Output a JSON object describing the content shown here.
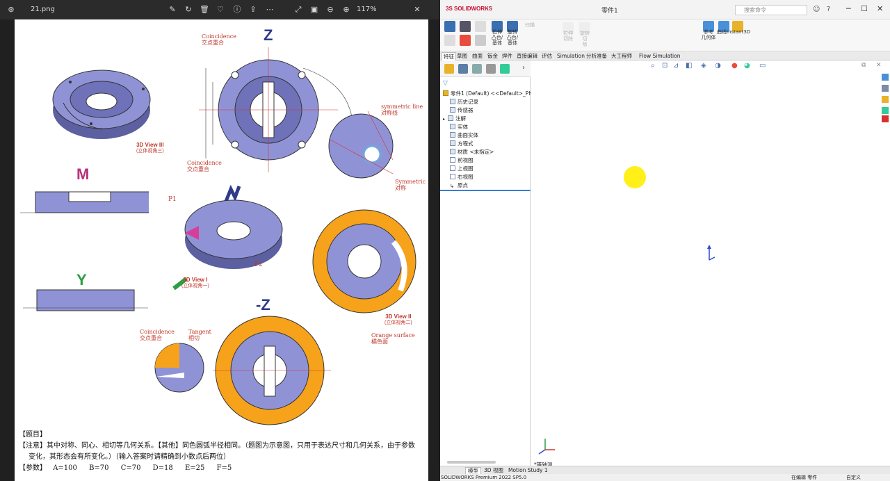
{
  "viewer": {
    "filename": "21.png",
    "zoom": "117%",
    "toolbar_icons": [
      "edit-icon",
      "rotate-icon",
      "delete-icon",
      "favorite-icon",
      "info-icon",
      "share-icon",
      "more-icon",
      "expand-icon",
      "crop-icon",
      "zoom-out-icon",
      "zoom-in-icon"
    ]
  },
  "drawing": {
    "views": {
      "z": "Z",
      "m": "M",
      "y": "Y",
      "neg_z": "-Z",
      "view3": {
        "title": "3D View III",
        "subtitle": "(立体视角三)"
      },
      "view1": {
        "title": "3D View I",
        "subtitle": "(立体视角一)"
      },
      "view2": {
        "title": "3D View II",
        "subtitle": "(立体视角二)"
      }
    },
    "labels": {
      "coincidence_top": "Coincidence",
      "coincidence_top_cn": "交点重合",
      "coincidence_mid": "Coincidence",
      "coincidence_mid_cn": "交点重合",
      "symmetric_line": "symmetric line",
      "symmetric_line_cn": "对称线",
      "symmetric": "Symmetric",
      "symmetric_cn": "对称",
      "p1": "P1",
      "p2": "P2",
      "coincidence_bottom": "Coincidence",
      "coincidence_bottom_cn": "交点重合",
      "tangent": "Tangent",
      "tangent_cn": "相切",
      "orange_surface": "Orange surface",
      "orange_surface_cn": "橘色面"
    },
    "notes": {
      "heading": "【题目】",
      "note_line1": "【注意】其中对称、同心、相切等几何关系。【其他】同色圆弧半径相同。（题图为示意图，只用于表达尺寸和几何关系，由于参数",
      "note_line2": "变化，其形态会有所变化。）（输入答案时请精确到小数点后两位）",
      "params_label": "【参数】",
      "params": [
        "A=100",
        "B=70",
        "C=70",
        "D=18",
        "E=25",
        "F=5"
      ]
    }
  },
  "solidworks": {
    "logo": "SOLIDWORKS",
    "document": "零件1",
    "search_placeholder": "搜索命令",
    "ribbon": {
      "extrude_boss": "拉伸\n凸台/\n基体",
      "revolve_boss": "旋转\n凸台/\n基体",
      "sweep": "扫描",
      "extrude_cut": "拉伸\n切除",
      "revolve_cut": "旋转\n切\n除",
      "ref_geometry": "参考\n几何体",
      "curves": "曲线",
      "instant3d": "Instant3D"
    },
    "tabs": [
      "特征",
      "草图",
      "曲面",
      "钣金",
      "焊件",
      "直接编辑",
      "评估",
      "Simulation",
      "分析准备",
      "大工程师",
      "Flow Simulation"
    ],
    "active_tab": "特征",
    "tree": {
      "root": "零件1 (Default) <<Default>_Photo",
      "items": [
        "历史记录",
        "传感器",
        "注解",
        "实体",
        "曲面实体",
        "方程式",
        "材质 <未指定>",
        "前视图",
        "上视图",
        "右视图",
        "原点"
      ]
    },
    "view_label": "*等轴测",
    "bottom_tabs": [
      "模型",
      "3D 视图",
      "Motion Study 1"
    ],
    "active_bottom_tab": "模型",
    "status_left": "SOLIDWORKS Premium 2022 SP5.0",
    "status_mid": "在编辑 零件",
    "status_right": "自定义"
  }
}
